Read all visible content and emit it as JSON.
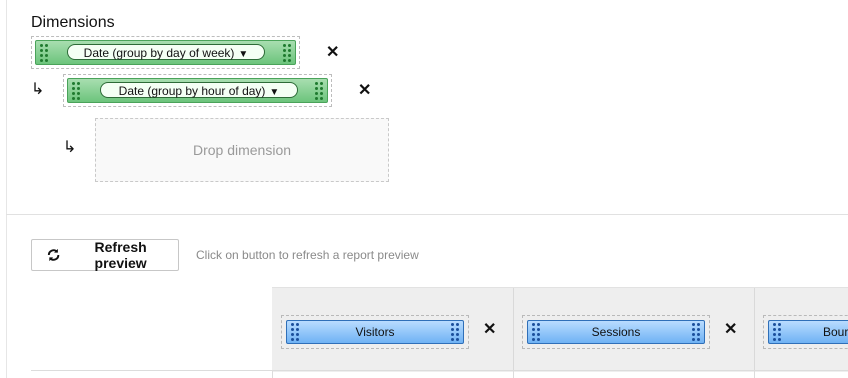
{
  "dimensions": {
    "title": "Dimensions",
    "items": [
      {
        "label": "Date (group by day of week)"
      },
      {
        "label": "Date (group by hour of day)"
      }
    ],
    "drop_placeholder": "Drop dimension",
    "remove_glyph": "✕",
    "nest_glyph": "↳"
  },
  "toolbar": {
    "refresh_label": "Refresh preview",
    "hint": "Click on button to refresh a report preview"
  },
  "metrics": {
    "columns": [
      {
        "label": "Visitors"
      },
      {
        "label": "Sessions"
      },
      {
        "label": "Bour"
      }
    ]
  },
  "colors": {
    "dimension_chip": "#6cc47c",
    "metric_chip": "#6fb2f4"
  }
}
